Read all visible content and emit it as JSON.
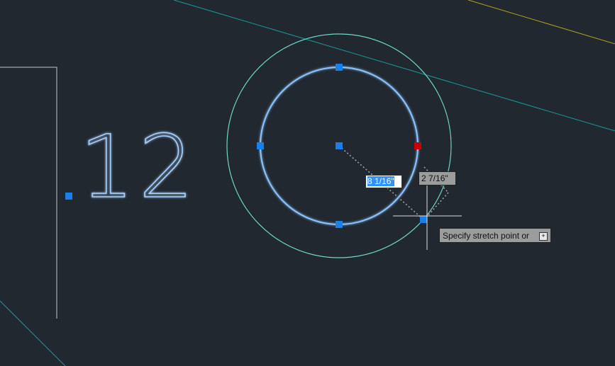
{
  "drawing": {
    "text_entity": "12",
    "colors": {
      "background": "#212830",
      "selected": "#5aa8ff",
      "teal": "#1a9a9a",
      "yellow": "#b0a020",
      "outer_circle": "#6fd8c8",
      "grip": "#1a7fe8",
      "hot_grip": "#c80000"
    }
  },
  "dynamic_input": {
    "radius_value": "8 1/16\"",
    "delta_value": "2 7/16\""
  },
  "command_prompt": {
    "text": "Specify stretch point or",
    "options_icon": "down-arrow-icon",
    "options_glyph": "+"
  }
}
